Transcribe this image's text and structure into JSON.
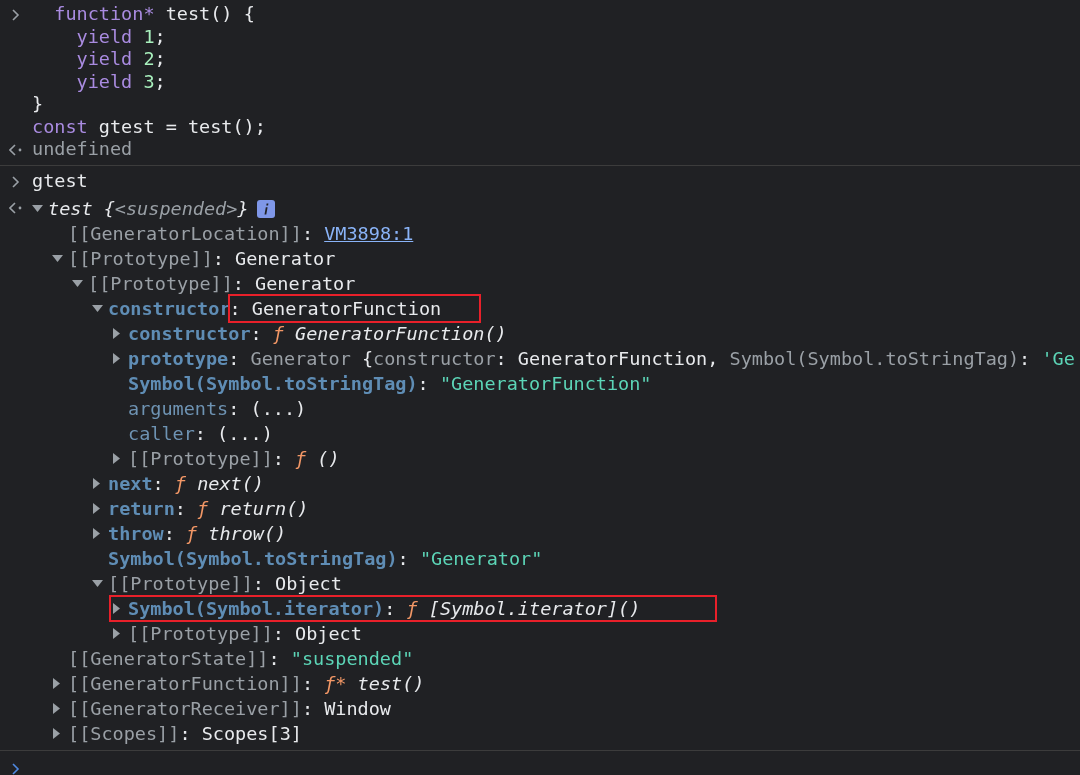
{
  "groups": [
    {
      "entries": [
        {
          "kind": "input",
          "lines": [
            [
              {
                "text": "  function*",
                "kind": "kw"
              },
              {
                "text": " test() {",
                "kind": "plain"
              }
            ],
            [
              {
                "text": "    yield ",
                "kind": "kw"
              },
              {
                "text": "1",
                "kind": "num"
              },
              {
                "text": ";",
                "kind": "plain"
              }
            ],
            [
              {
                "text": "    yield ",
                "kind": "kw"
              },
              {
                "text": "2",
                "kind": "num"
              },
              {
                "text": ";",
                "kind": "plain"
              }
            ],
            [
              {
                "text": "    yield ",
                "kind": "kw"
              },
              {
                "text": "3",
                "kind": "num"
              },
              {
                "text": ";",
                "kind": "plain"
              }
            ],
            [
              {
                "text": "}",
                "kind": "plain"
              }
            ],
            [
              {
                "text": "const ",
                "kind": "kw"
              },
              {
                "text": "gtest = test();",
                "kind": "plain"
              }
            ]
          ]
        },
        {
          "kind": "output",
          "lines": [
            [
              {
                "text": "undefined",
                "kind": "dim"
              }
            ]
          ]
        }
      ]
    },
    {
      "entries": [
        {
          "kind": "input",
          "lines": [
            [
              {
                "text": "gtest",
                "kind": "plain"
              }
            ]
          ]
        },
        {
          "kind": "tree",
          "root": {
            "expanded": true,
            "info": true,
            "tokens": [
              {
                "text": "test ",
                "kind": "italic"
              },
              {
                "text": "{",
                "kind": "italic"
              },
              {
                "text": "<suspended>",
                "kind": "italicdim"
              },
              {
                "text": "}",
                "kind": "italic"
              }
            ],
            "children": [
              {
                "tokens": [
                  {
                    "text": "[[GeneratorLocation]]",
                    "kind": "internal"
                  },
                  {
                    "text": ": ",
                    "kind": "plain"
                  },
                  {
                    "text": "VM3898:1",
                    "kind": "link"
                  }
                ]
              },
              {
                "expanded": true,
                "tokens": [
                  {
                    "text": "[[Prototype]]",
                    "kind": "internal"
                  },
                  {
                    "text": ": Generator",
                    "kind": "plain"
                  }
                ],
                "children": [
                  {
                    "expanded": true,
                    "tokens": [
                      {
                        "text": "[[Prototype]]",
                        "kind": "internal"
                      },
                      {
                        "text": ": Generator",
                        "kind": "plain"
                      }
                    ],
                    "children": [
                      {
                        "expanded": true,
                        "tokens": [
                          {
                            "text": "constructor",
                            "kind": "key"
                          },
                          {
                            "text": ": GeneratorFunction",
                            "kind": "plain",
                            "boxed": true
                          }
                        ],
                        "children": [
                          {
                            "expanded": false,
                            "tokens": [
                              {
                                "text": "constructor",
                                "kind": "key"
                              },
                              {
                                "text": ": ",
                                "kind": "plain"
                              },
                              {
                                "text": "ƒ ",
                                "kind": "fn"
                              },
                              {
                                "text": "GeneratorFunction()",
                                "kind": "italic"
                              }
                            ]
                          },
                          {
                            "expanded": false,
                            "tokens": [
                              {
                                "text": "prototype",
                                "kind": "key"
                              },
                              {
                                "text": ": ",
                                "kind": "plain"
                              },
                              {
                                "text": "Generator ",
                                "kind": "dim"
                              },
                              {
                                "text": "{",
                                "kind": "plain"
                              },
                              {
                                "text": "constructor",
                                "kind": "dim"
                              },
                              {
                                "text": ": GeneratorFunction, ",
                                "kind": "plain"
                              },
                              {
                                "text": "Symbol(Symbol.toStringTag)",
                                "kind": "dim"
                              },
                              {
                                "text": ": ",
                                "kind": "plain"
                              },
                              {
                                "text": "'Ge",
                                "kind": "str"
                              }
                            ]
                          },
                          {
                            "tokens": [
                              {
                                "text": "Symbol(Symbol.toStringTag)",
                                "kind": "key"
                              },
                              {
                                "text": ": ",
                                "kind": "plain"
                              },
                              {
                                "text": "\"GeneratorFunction\"",
                                "kind": "str"
                              }
                            ]
                          },
                          {
                            "tokens": [
                              {
                                "text": "arguments",
                                "kind": "keydim"
                              },
                              {
                                "text": ": (...)",
                                "kind": "plain"
                              }
                            ]
                          },
                          {
                            "tokens": [
                              {
                                "text": "caller",
                                "kind": "keydim"
                              },
                              {
                                "text": ": (...)",
                                "kind": "plain"
                              }
                            ]
                          },
                          {
                            "expanded": false,
                            "tokens": [
                              {
                                "text": "[[Prototype]]",
                                "kind": "internal"
                              },
                              {
                                "text": ": ",
                                "kind": "plain"
                              },
                              {
                                "text": "ƒ ",
                                "kind": "fn"
                              },
                              {
                                "text": "()",
                                "kind": "italic"
                              }
                            ]
                          }
                        ]
                      },
                      {
                        "expanded": false,
                        "tokens": [
                          {
                            "text": "next",
                            "kind": "key"
                          },
                          {
                            "text": ": ",
                            "kind": "plain"
                          },
                          {
                            "text": "ƒ ",
                            "kind": "fn"
                          },
                          {
                            "text": "next()",
                            "kind": "italic"
                          }
                        ]
                      },
                      {
                        "expanded": false,
                        "tokens": [
                          {
                            "text": "return",
                            "kind": "key"
                          },
                          {
                            "text": ": ",
                            "kind": "plain"
                          },
                          {
                            "text": "ƒ ",
                            "kind": "fn"
                          },
                          {
                            "text": "return()",
                            "kind": "italic"
                          }
                        ]
                      },
                      {
                        "expanded": false,
                        "tokens": [
                          {
                            "text": "throw",
                            "kind": "key"
                          },
                          {
                            "text": ": ",
                            "kind": "plain"
                          },
                          {
                            "text": "ƒ ",
                            "kind": "fn"
                          },
                          {
                            "text": "throw()",
                            "kind": "italic"
                          }
                        ]
                      },
                      {
                        "tokens": [
                          {
                            "text": "Symbol(Symbol.toStringTag)",
                            "kind": "key"
                          },
                          {
                            "text": ": ",
                            "kind": "plain"
                          },
                          {
                            "text": "\"Generator\"",
                            "kind": "str"
                          }
                        ]
                      },
                      {
                        "expanded": true,
                        "tokens": [
                          {
                            "text": "[[Prototype]]",
                            "kind": "internal"
                          },
                          {
                            "text": ": Object",
                            "kind": "plain"
                          }
                        ],
                        "children": [
                          {
                            "expanded": false,
                            "boxed": true,
                            "tokens": [
                              {
                                "text": "Symbol(Symbol.iterator)",
                                "kind": "key"
                              },
                              {
                                "text": ": ",
                                "kind": "plain"
                              },
                              {
                                "text": "ƒ ",
                                "kind": "fn"
                              },
                              {
                                "text": "[Symbol.iterator]()",
                                "kind": "italic"
                              }
                            ]
                          },
                          {
                            "expanded": false,
                            "tokens": [
                              {
                                "text": "[[Prototype]]",
                                "kind": "internal"
                              },
                              {
                                "text": ": Object",
                                "kind": "plain"
                              }
                            ]
                          }
                        ]
                      }
                    ]
                  }
                ]
              },
              {
                "tokens": [
                  {
                    "text": "[[GeneratorState]]",
                    "kind": "internal"
                  },
                  {
                    "text": ": ",
                    "kind": "plain"
                  },
                  {
                    "text": "\"suspended\"",
                    "kind": "str"
                  }
                ]
              },
              {
                "expanded": false,
                "tokens": [
                  {
                    "text": "[[GeneratorFunction]]",
                    "kind": "internal"
                  },
                  {
                    "text": ": ",
                    "kind": "plain"
                  },
                  {
                    "text": "ƒ* ",
                    "kind": "fn"
                  },
                  {
                    "text": "test()",
                    "kind": "italic"
                  }
                ]
              },
              {
                "expanded": false,
                "tokens": [
                  {
                    "text": "[[GeneratorReceiver]]",
                    "kind": "internal"
                  },
                  {
                    "text": ": Window",
                    "kind": "plain"
                  }
                ]
              },
              {
                "expanded": false,
                "tokens": [
                  {
                    "text": "[[Scopes]]",
                    "kind": "internal"
                  },
                  {
                    "text": ": Scopes[3]",
                    "kind": "plain"
                  }
                ]
              }
            ]
          }
        }
      ]
    },
    {
      "entries": [
        {
          "kind": "prompt"
        }
      ]
    }
  ]
}
